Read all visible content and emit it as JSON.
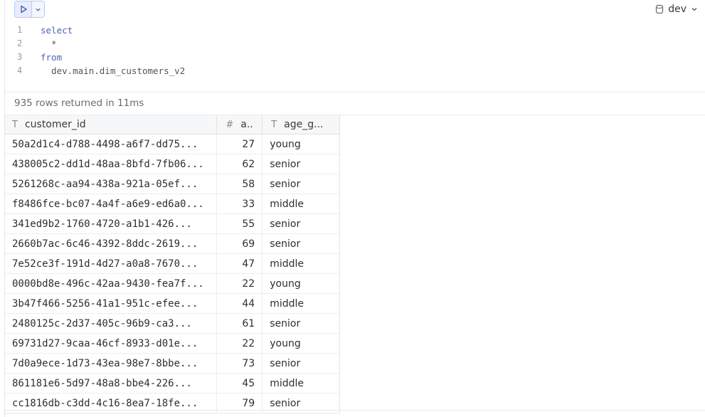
{
  "toolbar": {
    "run_icon": "play-icon",
    "menu_icon": "chevron-down-icon",
    "database": "dev",
    "database_icon": "database-icon"
  },
  "editor": {
    "lines": [
      {
        "num": "1",
        "text": "select"
      },
      {
        "num": "2",
        "text": "  *"
      },
      {
        "num": "3",
        "text": "from"
      },
      {
        "num": "4",
        "text": "  dev.main.dim_customers_v2"
      }
    ]
  },
  "results": {
    "status": "935 rows returned in 11ms",
    "columns": [
      {
        "type_icon": "T",
        "label": "customer_id"
      },
      {
        "type_icon": "#",
        "label": "a.."
      },
      {
        "type_icon": "T",
        "label": "age_g..."
      }
    ],
    "rows": [
      [
        "50a2d1c4-d788-4498-a6f7-dd75...",
        "27",
        "young"
      ],
      [
        "438005c2-dd1d-48aa-8bfd-7fb06...",
        "62",
        "senior"
      ],
      [
        "5261268c-aa94-438a-921a-05ef...",
        "58",
        "senior"
      ],
      [
        "f8486fce-bc07-4a4f-a6e9-ed6a0...",
        "33",
        "middle"
      ],
      [
        "341ed9b2-1760-4720-a1b1-426...",
        "55",
        "senior"
      ],
      [
        "2660b7ac-6c46-4392-8ddc-2619...",
        "69",
        "senior"
      ],
      [
        "7e52ce3f-191d-4d27-a0a8-7670...",
        "47",
        "middle"
      ],
      [
        "0000bd8e-496c-42aa-9430-fea7f...",
        "22",
        "young"
      ],
      [
        "3b47f466-5256-41a1-951c-efee...",
        "44",
        "middle"
      ],
      [
        "2480125c-2d37-405c-96b9-ca3...",
        "61",
        "senior"
      ],
      [
        "69731d27-9caa-46cf-8933-d01e...",
        "22",
        "young"
      ],
      [
        "7d0a9ece-1d73-43ea-98e7-8bbe...",
        "73",
        "senior"
      ],
      [
        "861181e6-5d97-48a8-bbe4-226...",
        "45",
        "middle"
      ],
      [
        "cc1816db-c3dd-4c16-8ea7-18fe...",
        "79",
        "senior"
      ]
    ]
  }
}
